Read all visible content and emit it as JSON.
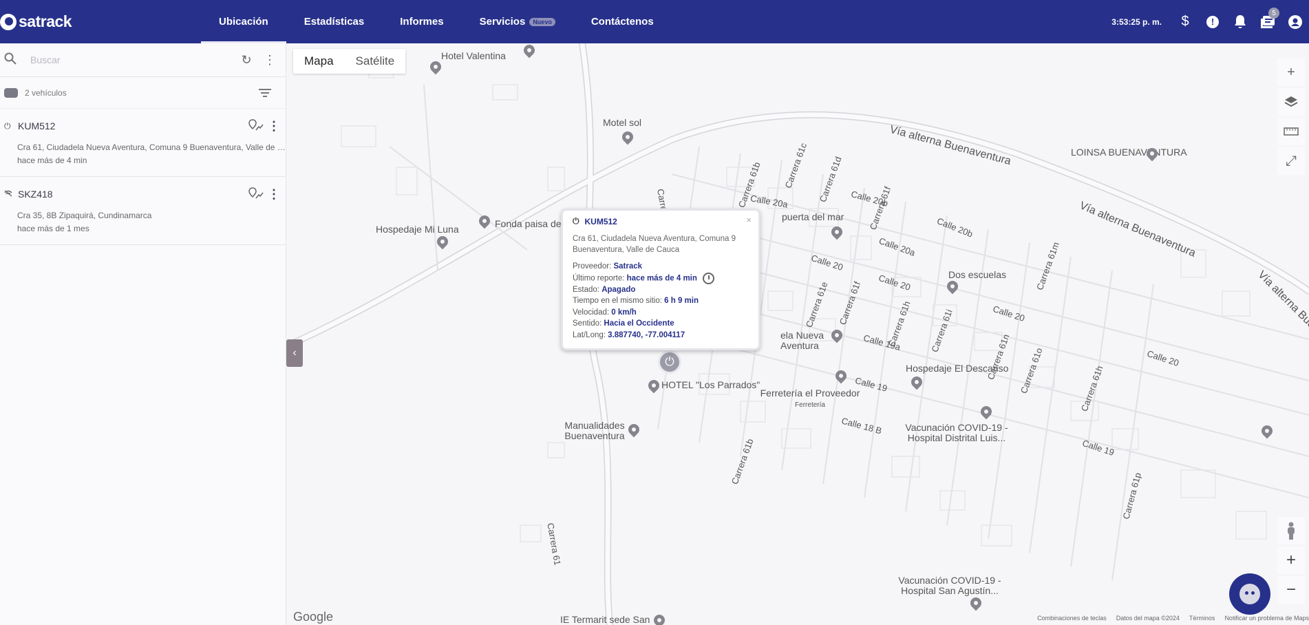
{
  "app": {
    "logo_text": "satrack"
  },
  "nav": {
    "items": [
      {
        "label": "Ubicación"
      },
      {
        "label": "Estadísticas"
      },
      {
        "label": "Informes"
      },
      {
        "label": "Servicios",
        "badge": "Nuevo"
      },
      {
        "label": "Contáctenos"
      }
    ]
  },
  "topbar": {
    "time": "3:53:25 p. m.",
    "notifications_count": "5"
  },
  "sidebar": {
    "search_placeholder": "Buscar",
    "vehicle_count": "2 vehículos",
    "vehicles": [
      {
        "plate": "KUM512",
        "address": "Cra 61, Ciudadela Nueva Aventura, Comuna 9 Buenaventura, Valle de Cauca",
        "last_report": "hace más de 4 min",
        "status_icon": "power-icon"
      },
      {
        "plate": "SKZ418",
        "address": "Cra 35, 8B Zipaquirá, Cundinamarca",
        "last_report": "hace más de 1 mes",
        "status_icon": "signal-icon"
      }
    ]
  },
  "map": {
    "type_options": [
      "Mapa",
      "Satélite"
    ],
    "selected_type": "Mapa",
    "google_label": "Google",
    "attribution": [
      "Combinaciones de teclas",
      "Datos del mapa ©2024",
      "Términos",
      "Notificar un problema de Maps"
    ],
    "pois": [
      {
        "name": "Hotel Valentina"
      },
      {
        "name": "Motel sol"
      },
      {
        "name": "Hospedaje Mi Luna"
      },
      {
        "name": "Fonda paisa de"
      },
      {
        "name": "puerta del mar"
      },
      {
        "name": "LOINSA BUENAVENTURA"
      },
      {
        "name": "Dos escuelas"
      },
      {
        "name": "ela Nueva Aventura"
      },
      {
        "name": "Hospedaje El Descanso"
      },
      {
        "name": "HOTEL \"Los Parrados\""
      },
      {
        "name": "Ferretería el Proveedor",
        "sub": "Ferretería"
      },
      {
        "name": "Manualidades Buenaventura"
      },
      {
        "name": "Vacunación COVID-19 - Hospital Distrital Luis..."
      },
      {
        "name": "Vacunación COVID-19 - Hospital San Agustín..."
      },
      {
        "name": "IE Termarit sede San"
      }
    ],
    "streets": [
      "Vía alterna Buenaventura",
      "Vía alterna Buenaventura",
      "Vía alterna Buenav",
      "Calle 20a",
      "Calle 20b",
      "Calle 20b",
      "Calle 20a",
      "Calle 20",
      "Calle 20",
      "Calle 20",
      "Calle 20",
      "Calle 19a",
      "Calle 19",
      "Calle 19",
      "Calle 18 B",
      "Carrera 61c",
      "Carrera 61d",
      "Carrera 61b",
      "Carrera 61f",
      "Carrera 61m",
      "Carrera 61e",
      "Carrera 61f",
      "Carrera 61h",
      "Carrera 61i",
      "Carrera 61n",
      "Carrera 61o",
      "Carrera 61h",
      "Carrera 61b",
      "Carrera 61p",
      "Carrera 61",
      "Carre"
    ]
  },
  "popup": {
    "plate": "KUM512",
    "address": "Cra 61, Ciudadela Nueva Aventura, Comuna 9 Buenaventura, Valle de Cauca",
    "rows": [
      {
        "label": "Proveedor:",
        "value": "Satrack"
      },
      {
        "label": "Último reporte:",
        "value": "hace más de 4 min"
      },
      {
        "label": "Estado:",
        "value": "Apagado"
      },
      {
        "label": "Tiempo en el mismo sitio:",
        "value": "6 h 9 min"
      },
      {
        "label": "Velocidad:",
        "value": "0 km/h"
      },
      {
        "label": "Sentido:",
        "value": "Hacia el Occidente"
      },
      {
        "label": "Lat/Long:",
        "value": "3.887740, -77.004117"
      }
    ]
  }
}
